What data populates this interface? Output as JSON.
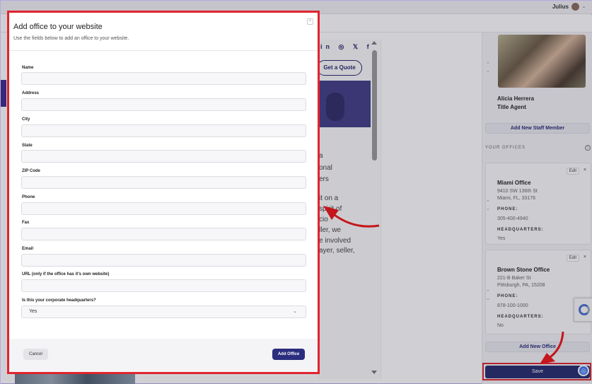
{
  "topbar": {
    "user_name": "Julius"
  },
  "preview": {
    "social_icons": [
      "linkedin-icon",
      "instagram-icon",
      "x-icon",
      "facebook-icon"
    ],
    "social_text": "in ◎ 𝕏 f",
    "quote_label": "Get a Quote",
    "bio_lines": [
      "a",
      "onal",
      "ers",
      "",
      "it on a",
      "spirit of",
      "cio",
      "ller, we",
      "e involved",
      "ayer, seller,"
    ]
  },
  "modal": {
    "title": "Add office to your website",
    "subtitle": "Use the fields below to add an office to your website.",
    "close_label": "×",
    "fields": [
      {
        "label": "Name",
        "value": ""
      },
      {
        "label": "Address",
        "value": ""
      },
      {
        "label": "City",
        "value": ""
      },
      {
        "label": "State",
        "value": ""
      },
      {
        "label": "ZIP Code",
        "value": ""
      },
      {
        "label": "Phone",
        "value": ""
      },
      {
        "label": "Fax",
        "value": ""
      },
      {
        "label": "Email",
        "value": ""
      },
      {
        "label": "URL (only if the office has it's own website)",
        "value": ""
      }
    ],
    "hq_label": "Is this your corporate headquarters?",
    "hq_value": "Yes",
    "cancel_label": "Cancel",
    "add_label": "Add Office"
  },
  "right_panel": {
    "staff": {
      "name": "Alicia Herrera",
      "title": "Title Agent"
    },
    "add_staff_label": "Add New Staff Member",
    "offices_label": "YOUR OFFICES",
    "offices": [
      {
        "title": "Miami Office",
        "address1": "9410 SW 136th St",
        "address2": "Miami, FL, 33176",
        "phone_label": "PHONE:",
        "phone": "305-400-4940",
        "hq_label": "HEADQUARTERS:",
        "hq": "Yes",
        "edit_label": "Edit",
        "remove_label": "×"
      },
      {
        "title": "Brown Stone Office",
        "address1": "221-B Baker St",
        "address2": "Pittsburgh, PA, 15208",
        "phone_label": "PHONE:",
        "phone": "878-100-1000",
        "hq_label": "HEADQUARTERS:",
        "hq": "No",
        "edit_label": "Edit",
        "remove_label": "×"
      }
    ],
    "add_office_label": "Add New Office",
    "save_label": "Save"
  },
  "colors": {
    "accent": "#2b2d7e",
    "highlight": "#e0242f",
    "overlay": "#28283c"
  }
}
